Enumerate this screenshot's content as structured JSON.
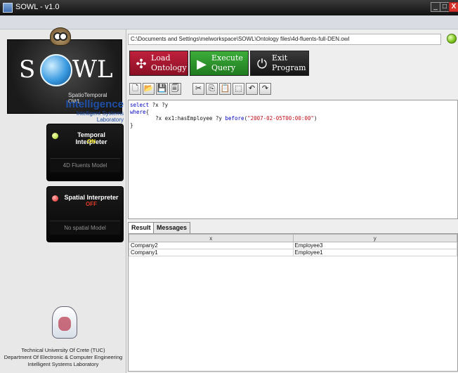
{
  "window": {
    "title": "SOWL - v1.0",
    "controls": {
      "minimize": "_",
      "maximize": "□",
      "close": "X"
    }
  },
  "sidebar": {
    "logo": {
      "left": "S",
      "right": "WL",
      "subtitle": "SpatioTemporal OWL"
    },
    "lab_logo": {
      "big": "Intelligence",
      "small": "Intelligent Systems Laboratory"
    },
    "temporal": {
      "title": "Temporal Interpreter",
      "state": "ON",
      "model": "4D Fluents Model",
      "led_color": "#9fcd22"
    },
    "spatial": {
      "title": "Spatial Interpreter",
      "state": "OFF",
      "model": "No spatial Model",
      "led_color": "#e0201b"
    },
    "footer": {
      "line1": "Technical University Of Crete (TUC)",
      "line2": "Department Of Electronic & Computer Engineering",
      "line3": "Intelligent Systems Laboratory"
    }
  },
  "main": {
    "path": "C:\\Documents and Settings\\melworkspace\\SOWL\\Ontology files\\4d-fluents-full-DEN.owl",
    "buttons": {
      "load": {
        "line1": "Load",
        "line2": "Ontology",
        "icon": "share-icon",
        "color": "#b01a33"
      },
      "execute": {
        "line1": "Execute",
        "line2": "Query",
        "icon": "play-icon",
        "color": "#2e9a2e"
      },
      "exit": {
        "line1": "Exit",
        "line2": "Program",
        "icon": "power-icon",
        "color": "#262626"
      }
    },
    "toolbar": [
      "new-file-icon",
      "open-folder-icon",
      "save-icon",
      "save-as-icon",
      "cut-icon",
      "copy-icon",
      "paste-icon",
      "select-all-icon",
      "undo-icon",
      "redo-icon"
    ],
    "query": {
      "line1_kw": "select",
      "line1_rest": " ?x ?y",
      "line2_kw": "where",
      "line2_rest": "{",
      "line3_pre": "        ?x ex1:hasEmployee ?y ",
      "line3_kw": "before",
      "line3_open": "(",
      "line3_str": "\"2007-02-05T00:00:00\"",
      "line3_close": ")",
      "line4": "}"
    },
    "tabs": {
      "result": "Result",
      "messages": "Messages"
    },
    "results": {
      "columns": [
        "x",
        "y"
      ],
      "rows": [
        [
          "Company2",
          "Employee3"
        ],
        [
          "Company1",
          "Employee1"
        ]
      ]
    }
  }
}
